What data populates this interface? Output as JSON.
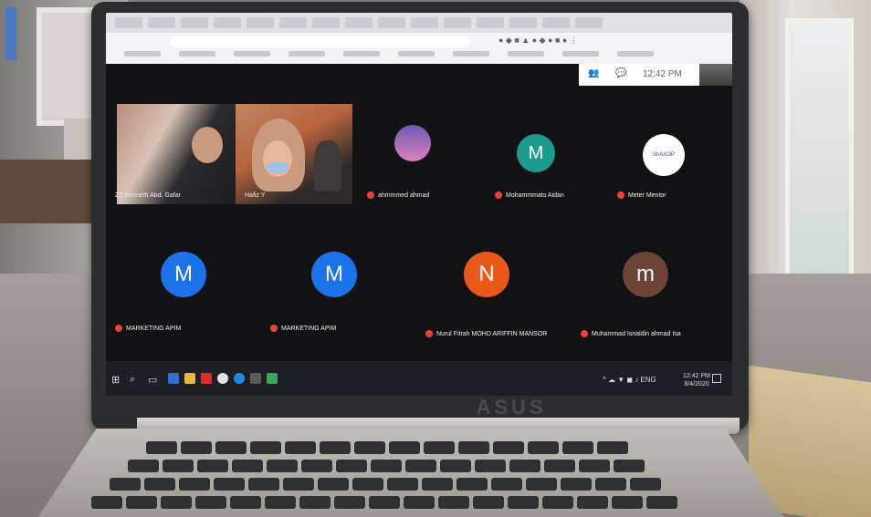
{
  "colors": {
    "mic_muted": "#ea4335",
    "avatar_teal": "#1a9b8e",
    "avatar_blue": "#1a73e8",
    "avatar_orange": "#e8591a",
    "avatar_brown": "#6d4437"
  },
  "laptop": {
    "brand": "ASUS"
  },
  "meet": {
    "panel_time": "12:42 PM",
    "participants": [
      {
        "name": "ZZ Kenneth Abd. Gafar",
        "type": "video"
      },
      {
        "name": "Hafiz Y",
        "type": "video"
      },
      {
        "name": "ahmmmed ahmad",
        "type": "photo"
      },
      {
        "name": "Mohammmats Aidan",
        "type": "avatar",
        "initial": "M",
        "color": "#1a9b8e"
      },
      {
        "name": "Meter Mentor",
        "type": "logo",
        "logo_text": "ShAXOP"
      },
      {
        "name": "MARKETING APIM",
        "type": "avatar",
        "initial": "M",
        "color": "#1a73e8"
      },
      {
        "name": "MARKETING APIM",
        "type": "avatar",
        "initial": "M",
        "color": "#1a73e8"
      },
      {
        "name": "Nurul Fitrah MOHD ARIFFIN MANSOR",
        "type": "avatar",
        "initial": "N",
        "color": "#e8591a"
      },
      {
        "name": "Muhammad Isnaldin ahmad Isa",
        "type": "avatar",
        "initial": "m",
        "color": "#6d4437"
      }
    ]
  },
  "taskbar": {
    "clock_time": "12:42 PM",
    "clock_date": "8/4/2020"
  }
}
